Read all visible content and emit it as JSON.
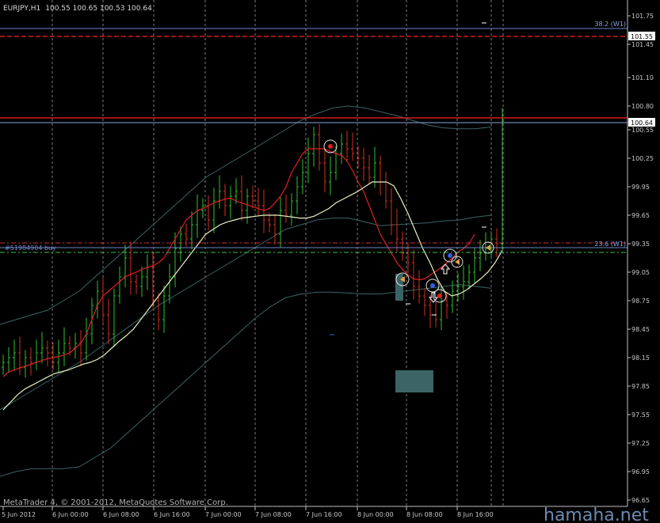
{
  "header": {
    "symbol": "EURJPY,H1",
    "ohlc": "100.55 100.65 100.53 100.64"
  },
  "levels": {
    "fib_382": "38.2 (W1)",
    "fib_236": "23.6 (W1)",
    "order": "#51984904 buy",
    "red_dashed_price": "101.55",
    "current_price": "100.64"
  },
  "footer": {
    "copyright": "MetaTrader 4, © 2001-2012, MetaQuotes Software Corp.",
    "watermark": "hamaha.net"
  },
  "colors": {
    "background": "#000000",
    "bull": "#2fbf2f",
    "bear": "#d03020",
    "ma_red": "#e02020",
    "ma_light": "#e8f0c0",
    "band": "#3c6464",
    "fib": "#6e86c8",
    "red_level": "#ff2020",
    "order": "#40c040"
  },
  "chart_data": {
    "type": "candlestick",
    "ylim": [
      96.65,
      101.75
    ],
    "y_ticks": [
      "101.75",
      "101.45",
      "101.10",
      "100.80",
      "100.55",
      "100.25",
      "99.95",
      "99.65",
      "99.35",
      "99.05",
      "98.75",
      "98.45",
      "98.15",
      "97.85",
      "97.55",
      "97.25",
      "96.95",
      "96.65"
    ],
    "x_ticks": [
      "5 Jun 2012",
      "6 Jun 00:00",
      "6 Jun 08:00",
      "6 Jun 16:00",
      "7 Jun 00:00",
      "7 Jun 08:00",
      "7 Jun 16:00",
      "8 Jun 00:00",
      "8 Jun 08:00",
      "8 Jun 16:00"
    ],
    "close": [
      98.1,
      98.15,
      98.2,
      98.05,
      98.15,
      98.1,
      98.2,
      98.25,
      98.2,
      98.1,
      98.2,
      98.3,
      98.25,
      98.3,
      98.2,
      98.4,
      98.7,
      98.85,
      98.6,
      98.4,
      98.8,
      99.0,
      99.2,
      98.95,
      98.9,
      99.0,
      99.1,
      98.75,
      98.55,
      98.8,
      99.0,
      99.3,
      99.45,
      99.4,
      99.55,
      99.7,
      99.75,
      99.6,
      99.8,
      99.9,
      99.75,
      99.85,
      99.9,
      99.7,
      99.85,
      99.8,
      99.75,
      99.6,
      99.55,
      99.45,
      99.7,
      99.65,
      99.8,
      99.95,
      100.1,
      100.3,
      100.5,
      100.2,
      100.0,
      100.1,
      100.3,
      100.4,
      100.35,
      100.3,
      100.25,
      100.15,
      100.05,
      100.2,
      100.0,
      99.8,
      99.55,
      99.4,
      99.25,
      99.15,
      98.9,
      98.8,
      98.7,
      98.6,
      98.55,
      98.75,
      98.7,
      98.85,
      98.9,
      98.95,
      99.05,
      99.2,
      99.25,
      99.3,
      99.4,
      99.35,
      100.64
    ],
    "ma_red": [
      97.95,
      98.0,
      98.02,
      98.04,
      98.06,
      98.08,
      98.1,
      98.12,
      98.14,
      98.15,
      98.16,
      98.18,
      98.2,
      98.25,
      98.3,
      98.4,
      98.55,
      98.7,
      98.8,
      98.85,
      98.9,
      98.95,
      99.0,
      99.03,
      99.05,
      99.08,
      99.1,
      99.12,
      99.15,
      99.2,
      99.3,
      99.4,
      99.5,
      99.6,
      99.65,
      99.7,
      99.72,
      99.75,
      99.78,
      99.8,
      99.82,
      99.83,
      99.8,
      99.78,
      99.76,
      99.74,
      99.72,
      99.7,
      99.72,
      99.78,
      99.85,
      99.95,
      100.1,
      100.2,
      100.3,
      100.35,
      100.35,
      100.35,
      100.35,
      100.32,
      100.3,
      100.28,
      100.22,
      100.12,
      100.0,
      99.9,
      99.75,
      99.6,
      99.45,
      99.35,
      99.25,
      99.15,
      99.08,
      99.02,
      98.98,
      98.97,
      98.98,
      99.02,
      99.06,
      99.1,
      99.15,
      99.2,
      99.26,
      99.3,
      99.35,
      99.45
    ],
    "ma_light": [
      97.6,
      97.68,
      97.76,
      97.82,
      97.86,
      97.9,
      97.94,
      97.98,
      98.0,
      98.02,
      98.05,
      98.08,
      98.1,
      98.13,
      98.18,
      98.25,
      98.32,
      98.38,
      98.45,
      98.55,
      98.65,
      98.75,
      98.85,
      98.95,
      99.05,
      99.15,
      99.25,
      99.35,
      99.45,
      99.5,
      99.55,
      99.58,
      99.6,
      99.62,
      99.63,
      99.64,
      99.65,
      99.65,
      99.65,
      99.64,
      99.63,
      99.62,
      99.62,
      99.64,
      99.68,
      99.72,
      99.78,
      99.82,
      99.86,
      99.9,
      99.95,
      100.0,
      100.0,
      100.0,
      99.96,
      99.82,
      99.66,
      99.48,
      99.3,
      99.15,
      98.98,
      98.85,
      98.8,
      98.82,
      98.86,
      98.92,
      98.98,
      99.05,
      99.15,
      99.28
    ],
    "band_upper": [
      98.5,
      98.55,
      98.6,
      98.65,
      98.75,
      98.85,
      99.0,
      99.15,
      99.3,
      99.45,
      99.6,
      99.75,
      99.9,
      100.05,
      100.15,
      100.25,
      100.35,
      100.45,
      100.55,
      100.65,
      100.72,
      100.78,
      100.8,
      100.78,
      100.74,
      100.7,
      100.65,
      100.6,
      100.57,
      100.56,
      100.56,
      100.58
    ],
    "band_mid": [
      97.6,
      97.7,
      97.8,
      97.9,
      98.0,
      98.1,
      98.22,
      98.34,
      98.46,
      98.58,
      98.7,
      98.8,
      98.9,
      99.0,
      99.1,
      99.2,
      99.3,
      99.4,
      99.5,
      99.55,
      99.6,
      99.62,
      99.62,
      99.58,
      99.54,
      99.55,
      99.56,
      99.57,
      99.59,
      99.6,
      99.63,
      99.65
    ],
    "band_lower": [
      96.9,
      96.95,
      96.98,
      96.98,
      96.98,
      97.0,
      97.1,
      97.2,
      97.35,
      97.5,
      97.65,
      97.8,
      97.95,
      98.1,
      98.25,
      98.4,
      98.55,
      98.68,
      98.78,
      98.82,
      98.84,
      98.84,
      98.83,
      98.82,
      98.82,
      98.84,
      98.86,
      98.88,
      98.9,
      98.92,
      98.9,
      98.88
    ]
  }
}
